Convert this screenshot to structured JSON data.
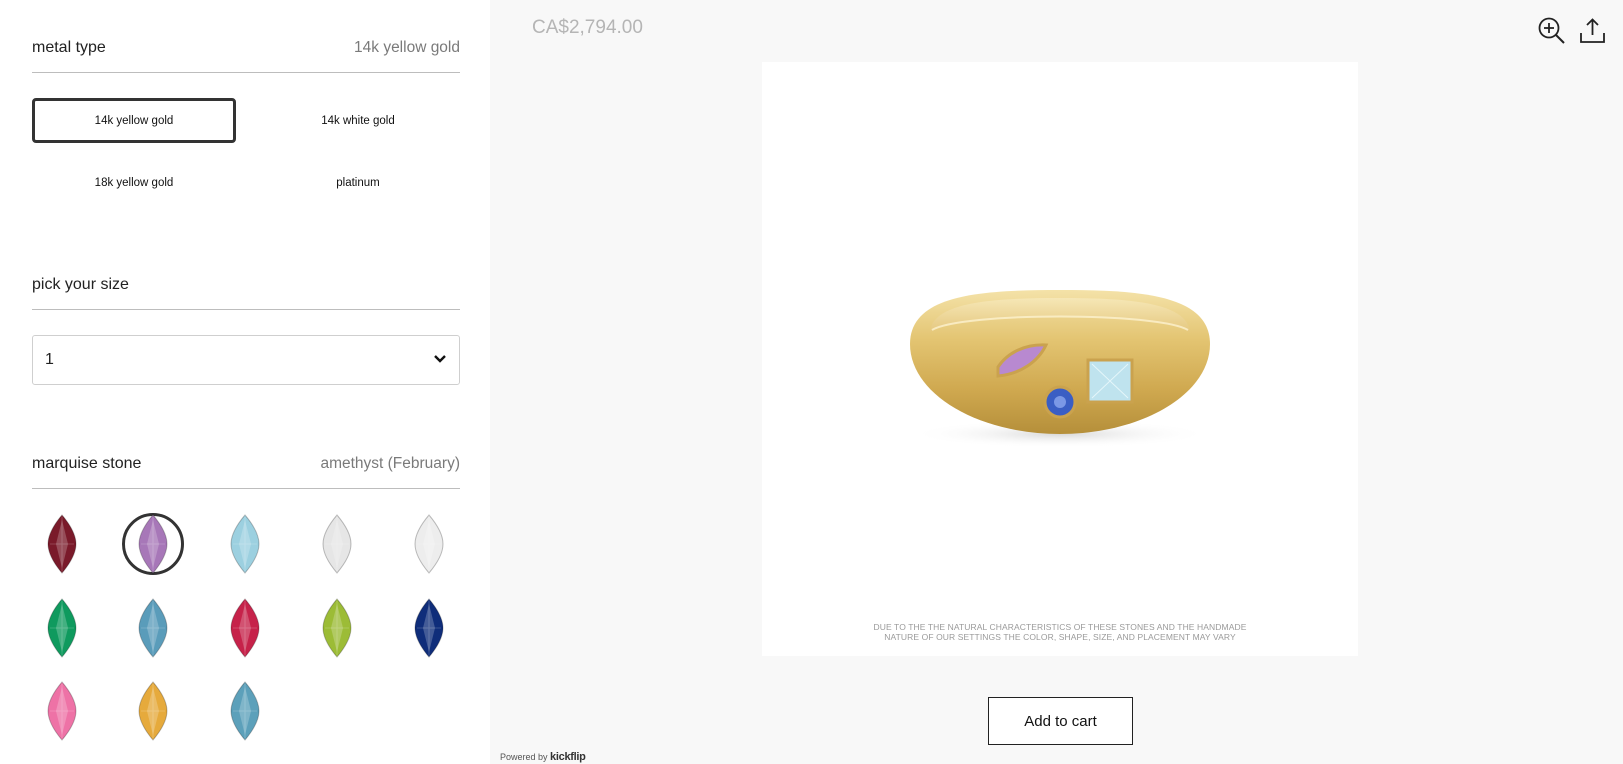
{
  "metal": {
    "title": "metal type",
    "selected_value": "14k yellow gold",
    "options": [
      "14k yellow gold",
      "14k white gold",
      "18k yellow gold",
      "platinum"
    ]
  },
  "size": {
    "title": "pick your size",
    "value": "1"
  },
  "stone": {
    "title": "marquise stone",
    "selected_value": "amethyst (February)",
    "swatch_colors": [
      "#7a1a2a",
      "#a777b8",
      "#9cd0e0",
      "#e6e6e6",
      "#ededed",
      "#0f9a5e",
      "#5a9cba",
      "#c6224a",
      "#9cbc36",
      "#0f2d7a",
      "#ee72a6",
      "#e6aa3c",
      "#5ca0ba"
    ]
  },
  "product": {
    "price": "CA$2,794.00",
    "disclaimer_line1": "DUE TO THE THE NATURAL CHARACTERISTICS OF THESE STONES AND THE HANDMADE",
    "disclaimer_line2": "NATURE OF OUR SETTINGS THE COLOR, SHAPE, SIZE, AND PLACEMENT MAY VARY",
    "add_to_cart": "Add to cart"
  },
  "footer": {
    "powered_by": "Powered by",
    "brand": "kickflip"
  }
}
